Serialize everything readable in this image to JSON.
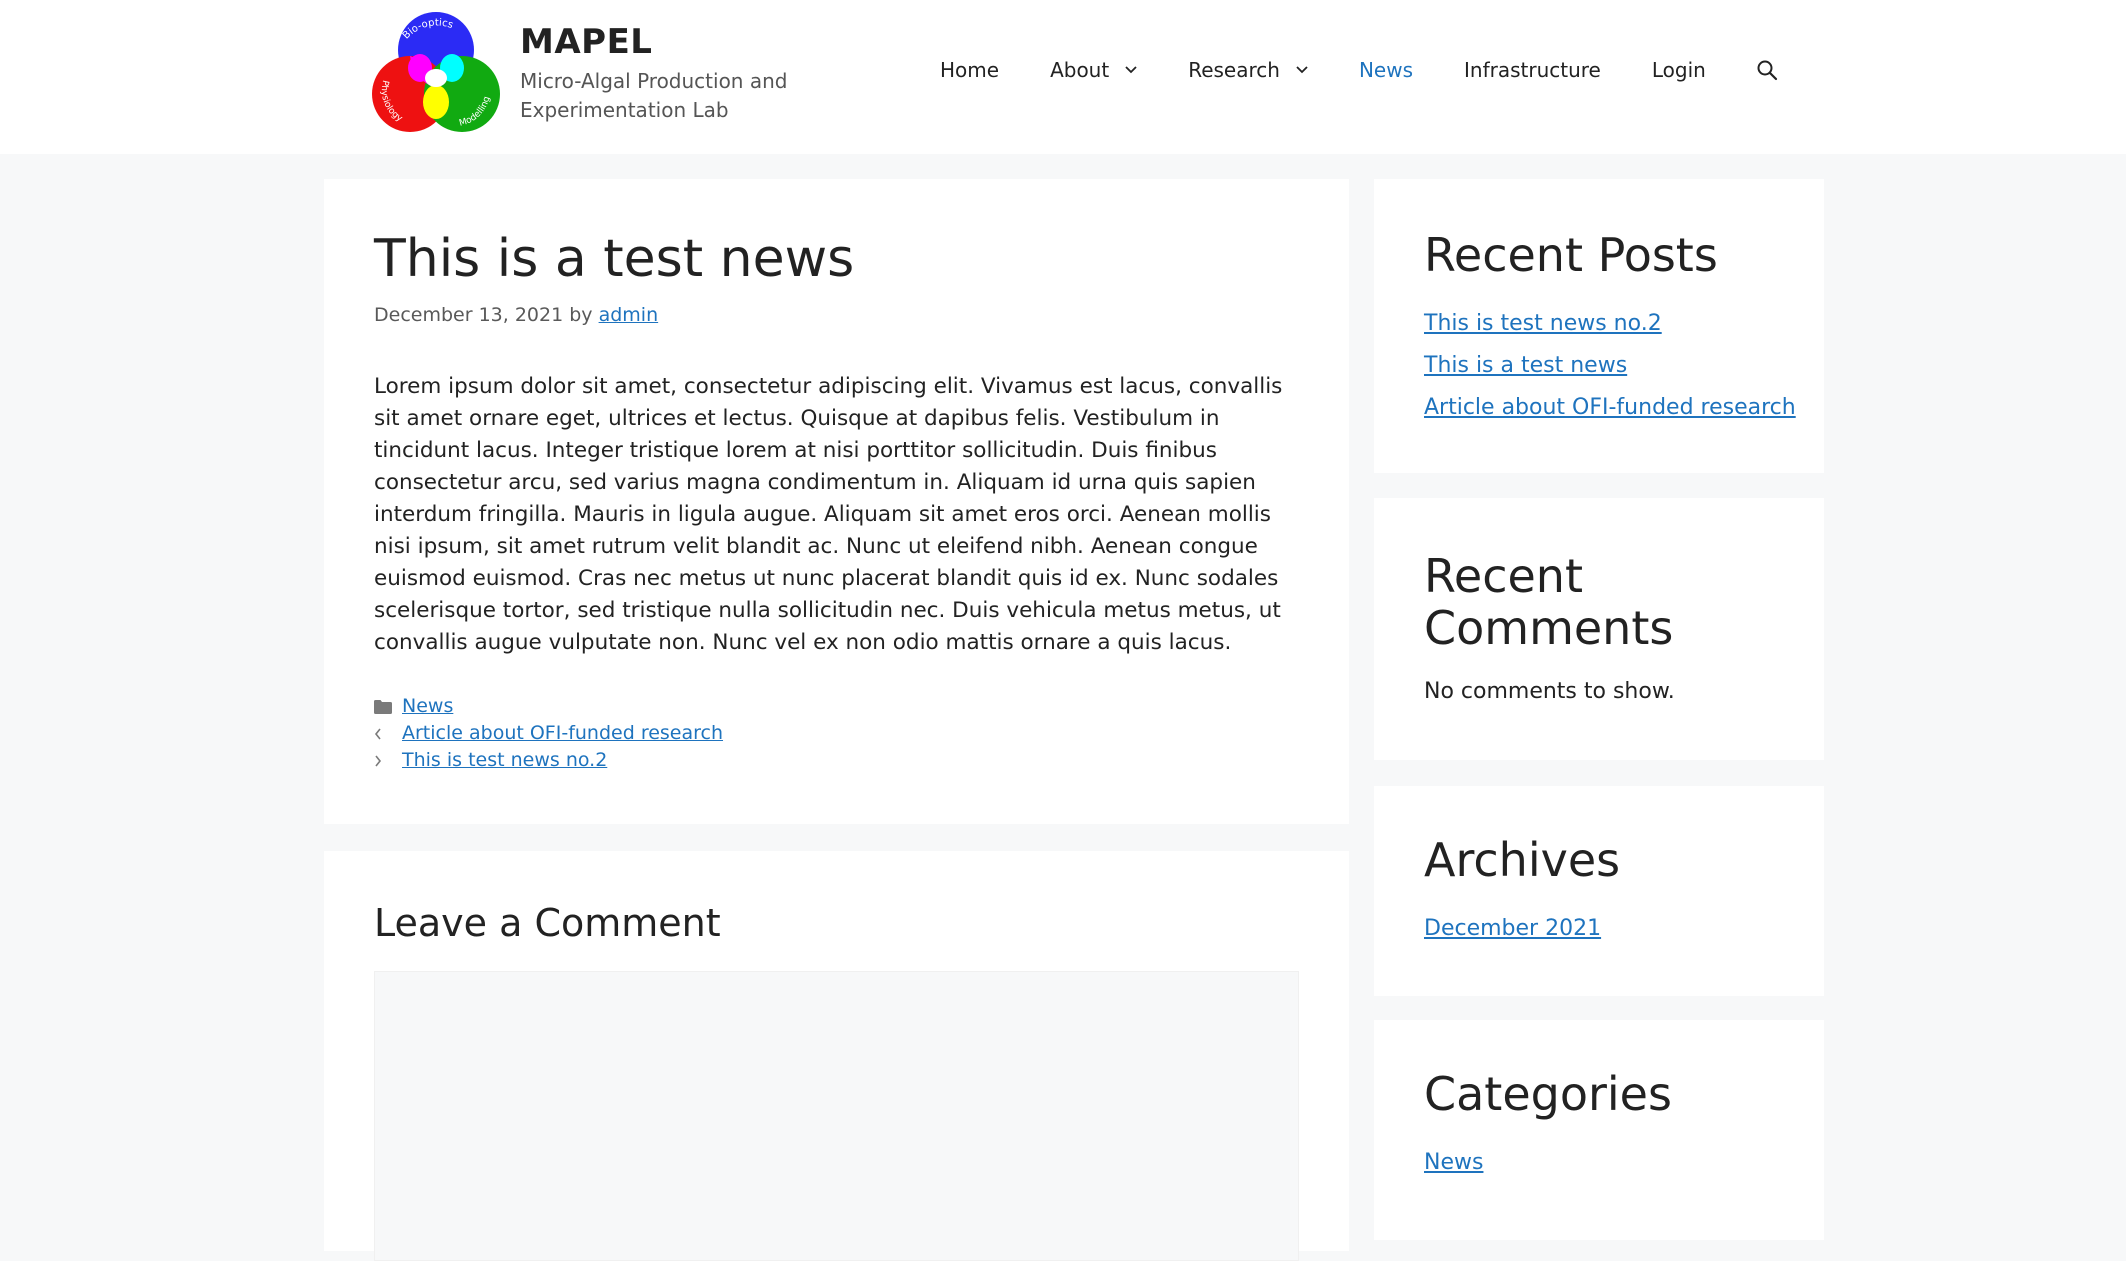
{
  "site": {
    "title": "MAPEL",
    "description": "Micro-Algal Production and Experimentation Lab",
    "logo_labels": {
      "top": "Bio-optics",
      "left": "Physiology",
      "right": "Modelling"
    },
    "colors": {
      "link": "#1e73be",
      "circle_blue": "#2b2bf5",
      "circle_red": "#ee1111",
      "circle_green": "#11aa11"
    }
  },
  "nav": {
    "items": [
      {
        "label": "Home"
      },
      {
        "label": "About",
        "has_dropdown": true
      },
      {
        "label": "Research",
        "has_dropdown": true
      },
      {
        "label": "News",
        "active": true
      },
      {
        "label": "Infrastructure"
      },
      {
        "label": "Login"
      }
    ],
    "search_icon": "search-icon",
    "dropdown_icon": "chevron-down-icon"
  },
  "post": {
    "title": "This is a test news",
    "date": "December 13, 2021",
    "by": "by",
    "author": "admin",
    "body": "Lorem ipsum dolor sit amet, consectetur adipiscing elit. Vivamus est lacus, convallis sit amet ornare eget, ultrices et lectus. Quisque at dapibus felis. Vestibulum in tincidunt lacus. Integer tristique lorem at nisi porttitor sollicitudin. Duis finibus consectetur arcu, sed varius magna condimentum in. Aliquam id urna quis sapien interdum fringilla. Mauris in ligula augue. Aliquam sit amet eros orci. Aenean mollis nisi ipsum, sit amet rutrum velit blandit ac. Nunc ut eleifend nibh. Aenean congue euismod euismod. Cras nec metus ut nunc placerat blandit quis id ex. Nunc sodales scelerisque tortor, sed tristique nulla sollicitudin nec. Duis vehicula metus metus, ut convallis augue vulputate non. Nunc vel ex non odio mattis ornare a quis lacus.",
    "category": "News",
    "category_icon": "folder-icon",
    "prev_post": "Article about OFI-funded research",
    "prev_icon": "chevron-left-icon",
    "next_post": "This is test news no.2",
    "next_icon": "chevron-right-icon"
  },
  "comments": {
    "title": "Leave a Comment"
  },
  "sidebar": {
    "recent_posts": {
      "title": "Recent Posts",
      "items": [
        "This is test news no.2",
        "This is a test news",
        "Article about OFI-funded research"
      ]
    },
    "recent_comments": {
      "title": "Recent Comments",
      "empty": "No comments to show."
    },
    "archives": {
      "title": "Archives",
      "items": [
        "December 2021"
      ]
    },
    "categories": {
      "title": "Categories",
      "items": [
        "News"
      ]
    }
  }
}
